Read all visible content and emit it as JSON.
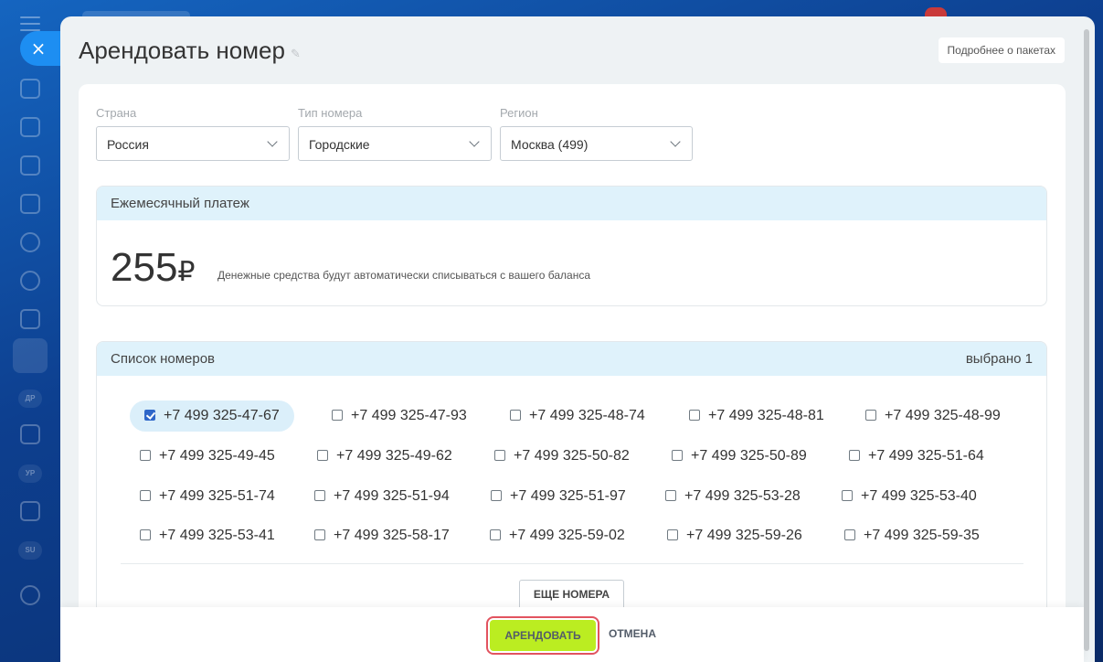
{
  "page": {
    "title": "Арендовать номер",
    "more_packages": "Подробнее о пакетах"
  },
  "filters": {
    "country": {
      "label": "Страна",
      "value": "Россия"
    },
    "number_type": {
      "label": "Тип номера",
      "value": "Городские"
    },
    "region": {
      "label": "Регион",
      "value": "Москва (499)"
    }
  },
  "payment": {
    "header": "Ежемесячный платеж",
    "amount": "255",
    "currency": "₽",
    "note": "Денежные средства будут автоматически списываться с вашего баланса"
  },
  "numbers": {
    "header": "Список номеров",
    "selected_count": "выбрано 1",
    "items": [
      {
        "number": "+7 499 325-47-67",
        "checked": true
      },
      {
        "number": "+7 499 325-47-93",
        "checked": false
      },
      {
        "number": "+7 499 325-48-74",
        "checked": false
      },
      {
        "number": "+7 499 325-48-81",
        "checked": false
      },
      {
        "number": "+7 499 325-48-99",
        "checked": false
      },
      {
        "number": "+7 499 325-49-45",
        "checked": false
      },
      {
        "number": "+7 499 325-49-62",
        "checked": false
      },
      {
        "number": "+7 499 325-50-82",
        "checked": false
      },
      {
        "number": "+7 499 325-50-89",
        "checked": false
      },
      {
        "number": "+7 499 325-51-64",
        "checked": false
      },
      {
        "number": "+7 499 325-51-74",
        "checked": false
      },
      {
        "number": "+7 499 325-51-94",
        "checked": false
      },
      {
        "number": "+7 499 325-51-97",
        "checked": false
      },
      {
        "number": "+7 499 325-53-28",
        "checked": false
      },
      {
        "number": "+7 499 325-53-40",
        "checked": false
      },
      {
        "number": "+7 499 325-53-41",
        "checked": false
      },
      {
        "number": "+7 499 325-58-17",
        "checked": false
      },
      {
        "number": "+7 499 325-59-02",
        "checked": false
      },
      {
        "number": "+7 499 325-59-26",
        "checked": false
      },
      {
        "number": "+7 499 325-59-35",
        "checked": false
      }
    ],
    "more_button": "ЕЩЕ НОМЕРА"
  },
  "footer": {
    "rent_button": "АРЕНДОВАТЬ",
    "cancel_button": "ОТМЕНА"
  },
  "sidebar": {
    "close_icon": "×",
    "badges": [
      "ДР",
      "УР",
      "SU"
    ]
  },
  "colors": {
    "accent_blue": "#1d8ef2",
    "header_tint": "#dff2fb",
    "rent_button": "#bbed21",
    "highlight_border": "#e2535f"
  }
}
